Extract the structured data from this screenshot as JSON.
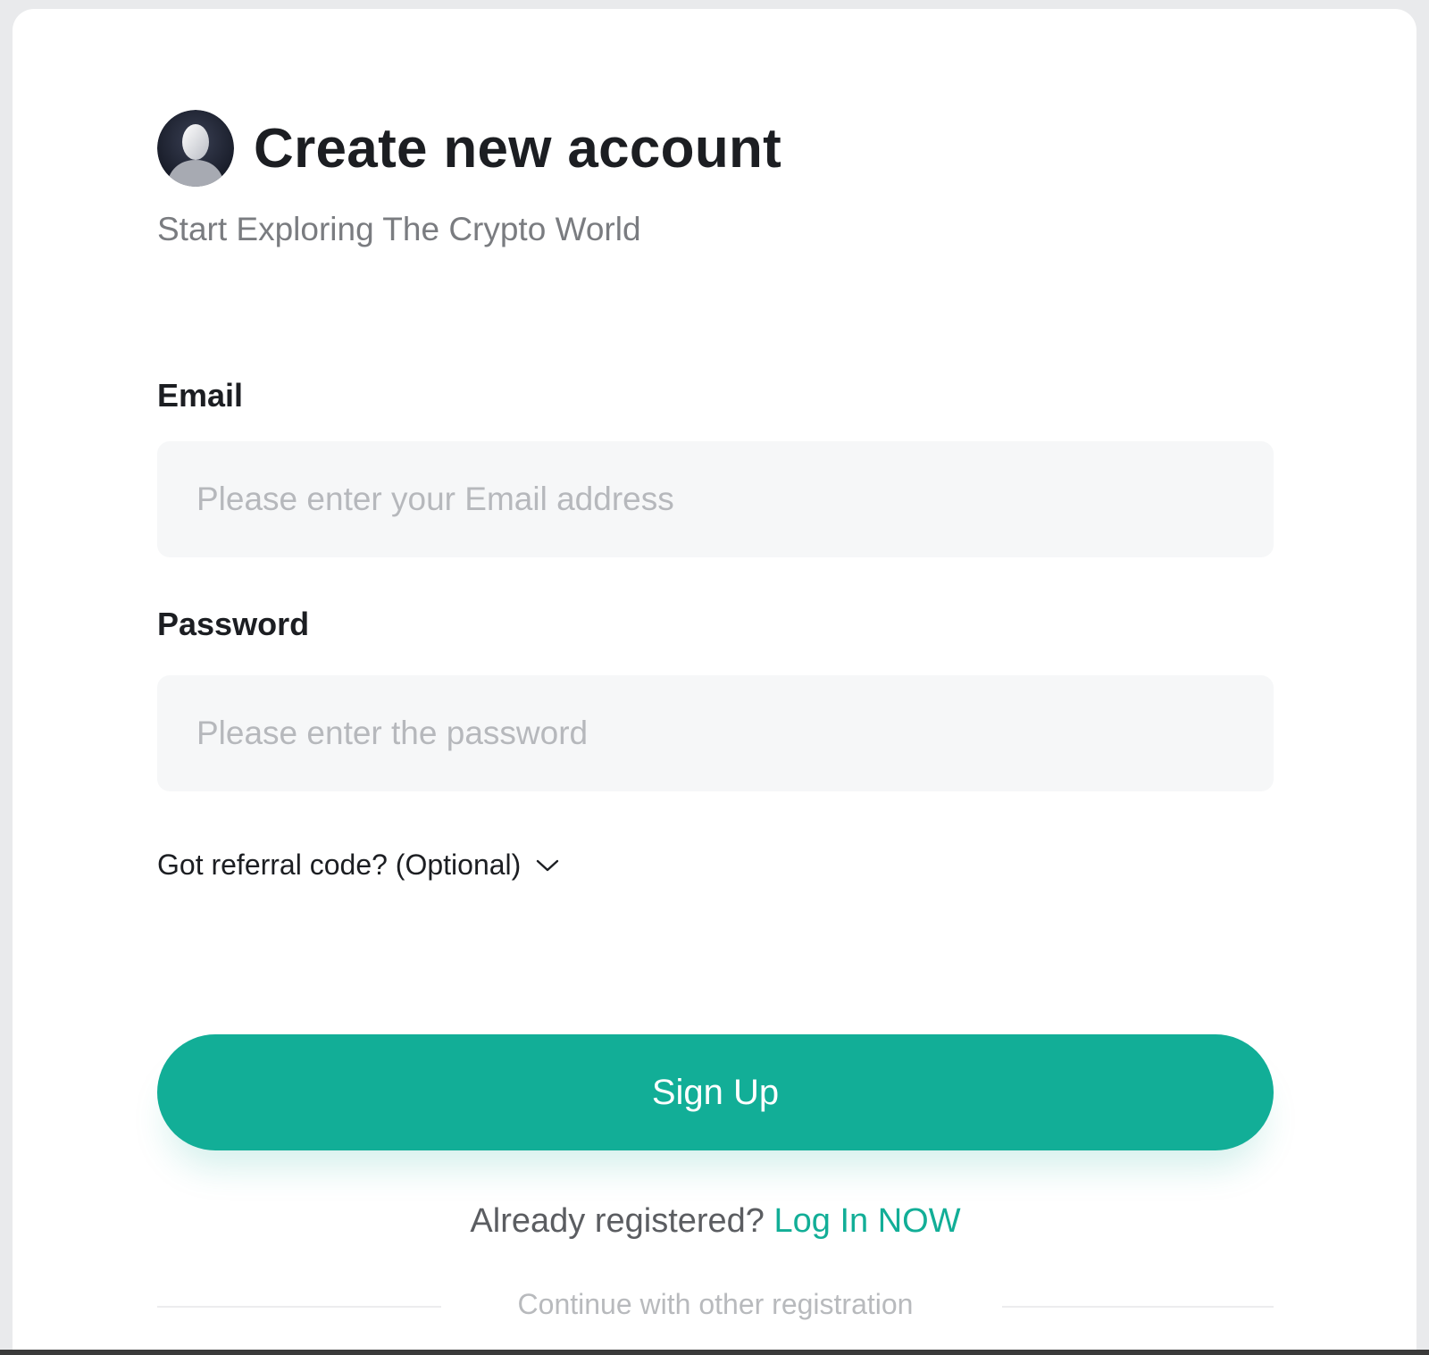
{
  "header": {
    "title": "Create new account",
    "subtitle": "Start Exploring The Crypto World"
  },
  "form": {
    "email_label": "Email",
    "email_placeholder": "Please enter your Email address",
    "email_value": "",
    "password_label": "Password",
    "password_placeholder": "Please enter the password",
    "password_value": "",
    "referral_label": "Got referral code? (Optional)",
    "referral_icon": "chevron-down-icon",
    "signup_label": "Sign Up"
  },
  "footer": {
    "login_prefix": "Already registered?",
    "login_link": "Log In NOW",
    "alt_registration": "Continue with other registration"
  },
  "colors": {
    "accent": "#12ae97",
    "title_text": "#1c1e22",
    "subtitle_text": "#7a7c80",
    "input_bg": "#f6f7f8",
    "placeholder": "#b6b8bc"
  }
}
